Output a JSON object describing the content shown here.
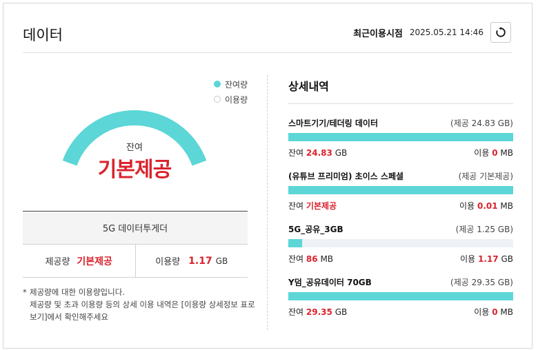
{
  "header": {
    "title": "데이터",
    "recent_label": "최근이용시점",
    "recent_datetime": "2025.05.21 14:46"
  },
  "legend": {
    "remaining": "잔여량",
    "used": "이용량"
  },
  "gauge": {
    "remaining_fraction": 1.0,
    "label": "잔여",
    "value": "기본제공"
  },
  "plan": {
    "name": "5G 데이터투게더",
    "provided_label": "제공량",
    "provided_value": "기본제공",
    "used_label": "이용량",
    "used_value": "1.17",
    "used_unit": "GB"
  },
  "note": {
    "star": "*",
    "line1": "제공량에 대한 이용량입니다.",
    "line2": "제공량 및 초과 이용량 등의 상세 이용 내역은 [이용량 상세정보 표로보기]에서 확인해주세요"
  },
  "details": {
    "title": "상세내역",
    "remain_prefix": "잔여",
    "used_prefix": "이용",
    "items": [
      {
        "name": "스마트기기/테더링 데이터",
        "provided": "(제공 24.83 GB)",
        "remain_value": "24.83",
        "remain_unit": "GB",
        "used_value": "0",
        "used_unit": "MB",
        "fill": 1.0
      },
      {
        "name": "(유튜브 프리미엄) 초이스 스페셜",
        "provided": "(제공 기본제공)",
        "remain_value": "기본제공",
        "remain_unit": "",
        "used_value": "0.01",
        "used_unit": "MB",
        "fill": 1.0
      },
      {
        "name": "5G_공유_3GB",
        "provided": "(제공 1.25 GB)",
        "remain_value": "86",
        "remain_unit": "MB",
        "used_value": "1.17",
        "used_unit": "GB",
        "fill": 0.06
      },
      {
        "name": "Y덤_공유데이터 70GB",
        "provided": "(제공 29.35 GB)",
        "remain_value": "29.35",
        "remain_unit": "GB",
        "used_value": "0",
        "used_unit": "MB",
        "fill": 1.0
      }
    ]
  },
  "colors": {
    "accent": "#5cd6d6",
    "highlight": "#d9232d",
    "track": "#eef1f6"
  }
}
